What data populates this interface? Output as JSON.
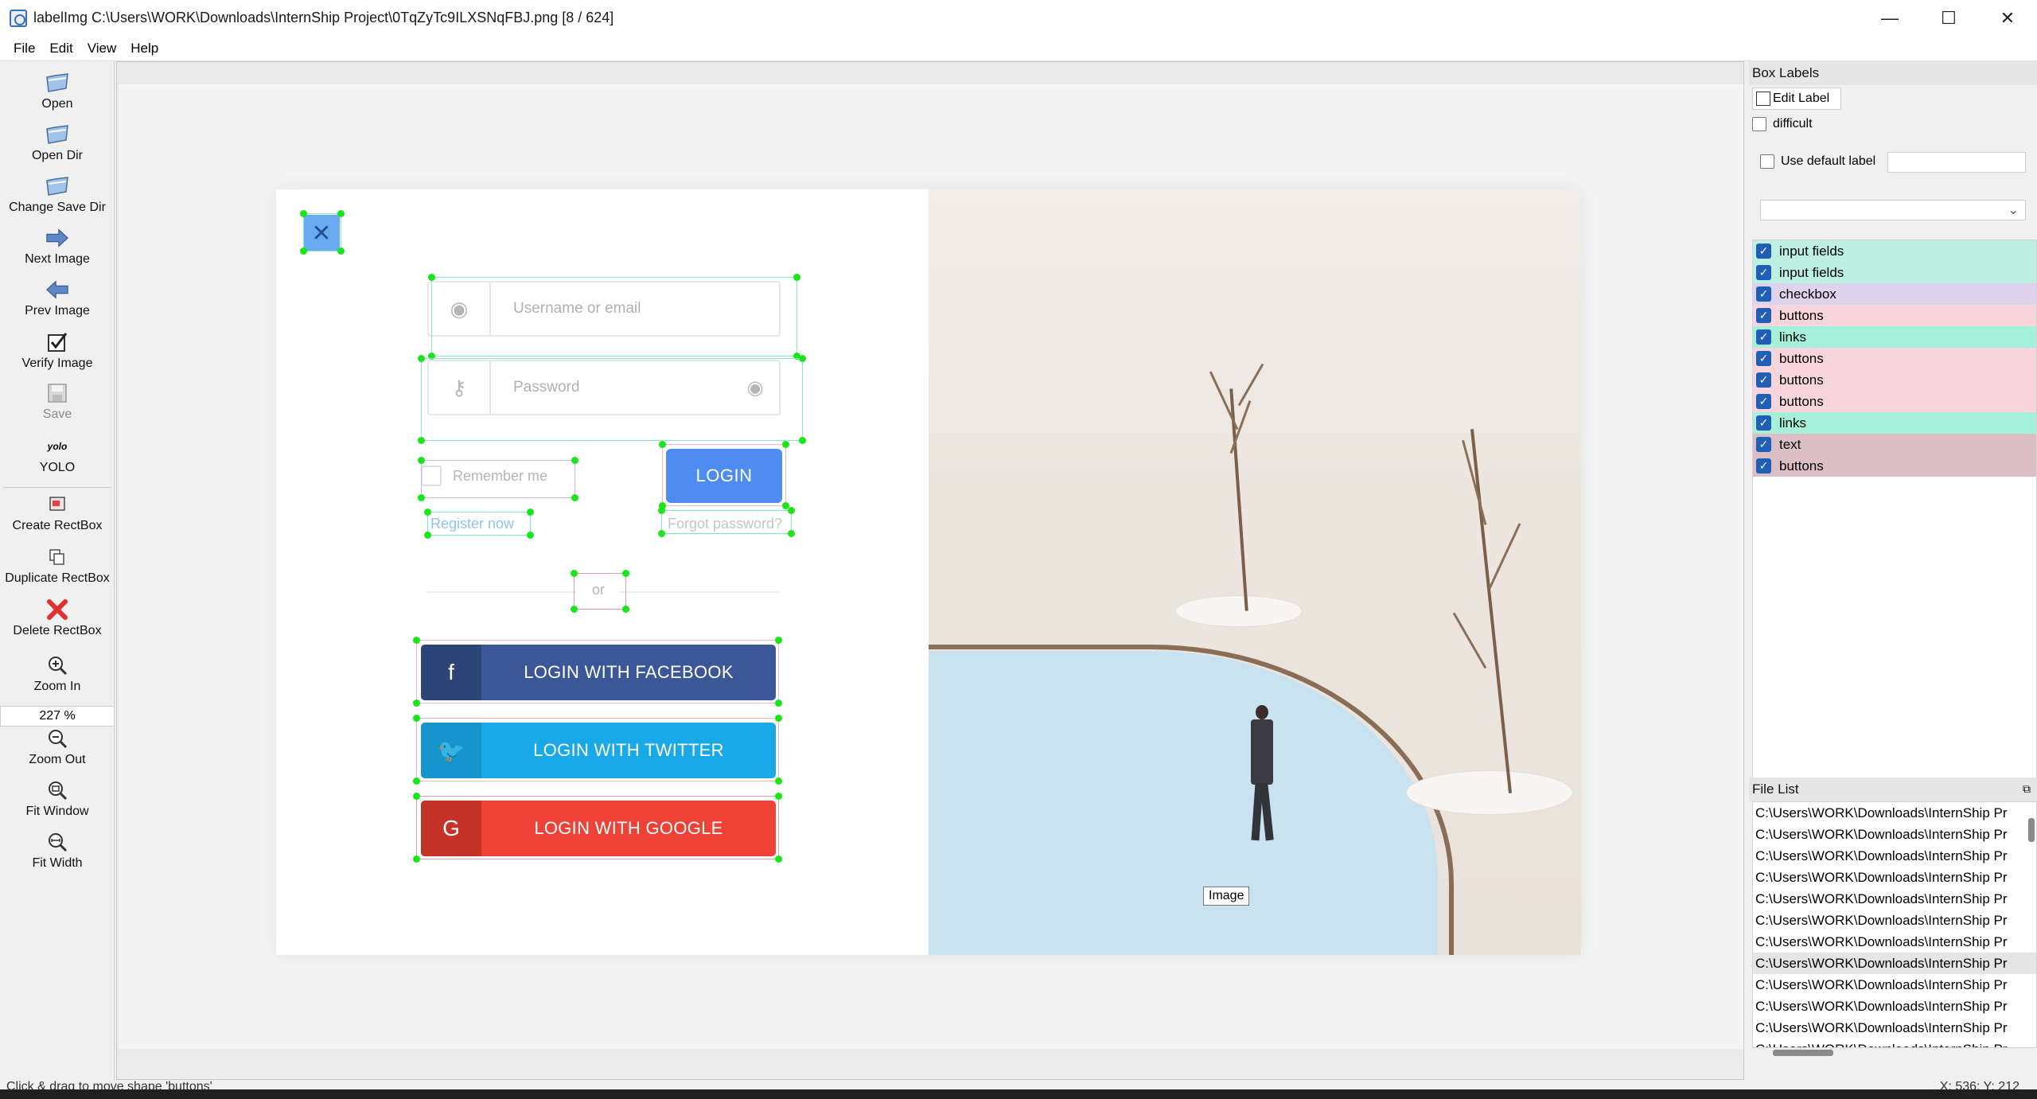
{
  "window": {
    "title": "labelImg C:\\Users\\WORK\\Downloads\\InternShip Project\\0TqZyTc9ILXSNqFBJ.png [8 / 624]",
    "minimize": "—",
    "maximize": "☐",
    "close": "✕"
  },
  "menu": [
    "File",
    "Edit",
    "View",
    "Help"
  ],
  "toolbar": {
    "open": "Open",
    "open_dir": "Open Dir",
    "change_save_dir": "Change Save Dir",
    "next_image": "Next Image",
    "prev_image": "Prev Image",
    "verify_image": "Verify Image",
    "save": "Save",
    "yolo_icon_text": "yolo",
    "yolo": "YOLO",
    "create_rectbox": "Create RectBox",
    "duplicate_rectbox": "Duplicate RectBox",
    "delete_rectbox": "Delete RectBox",
    "zoom_in": "Zoom In",
    "zoom_value": "227 %",
    "zoom_out": "Zoom Out",
    "fit_window": "Fit Window",
    "fit_width": "Fit Width"
  },
  "canvas": {
    "tooltip": "Image",
    "form": {
      "username_placeholder": "Username or email",
      "password_placeholder": "Password",
      "remember_me": "Remember me",
      "login": "LOGIN",
      "register_now": "Register now",
      "forgot_password": "Forgot password?",
      "or": "or",
      "facebook": "LOGIN WITH FACEBOOK",
      "twitter": "LOGIN WITH TWITTER",
      "google": "LOGIN WITH GOOGLE",
      "close_symbol": "✕"
    }
  },
  "box_labels": {
    "title": "Box Labels",
    "edit_label": "Edit Label",
    "difficult": "difficult",
    "use_default_label": "Use default label",
    "labels": [
      {
        "text": "input fields",
        "color": "#bdf0e2"
      },
      {
        "text": "input fields",
        "color": "#bdf0e2"
      },
      {
        "text": "checkbox",
        "color": "#ded2ec"
      },
      {
        "text": "buttons",
        "color": "#f8d4dc"
      },
      {
        "text": "links",
        "color": "#a6f0da"
      },
      {
        "text": "buttons",
        "color": "#f8d4dc"
      },
      {
        "text": "buttons",
        "color": "#f8d4dc"
      },
      {
        "text": "buttons",
        "color": "#f8d4dc"
      },
      {
        "text": "links",
        "color": "#a6f0da"
      },
      {
        "text": "text",
        "color": "#dcbfc6"
      },
      {
        "text": "buttons",
        "color": "#dcbfc6"
      }
    ]
  },
  "file_list": {
    "title": "File List",
    "items": [
      "C:\\Users\\WORK\\Downloads\\InternShip Pr",
      "C:\\Users\\WORK\\Downloads\\InternShip Pr",
      "C:\\Users\\WORK\\Downloads\\InternShip Pr",
      "C:\\Users\\WORK\\Downloads\\InternShip Pr",
      "C:\\Users\\WORK\\Downloads\\InternShip Pr",
      "C:\\Users\\WORK\\Downloads\\InternShip Pr",
      "C:\\Users\\WORK\\Downloads\\InternShip Pr",
      "C:\\Users\\WORK\\Downloads\\InternShip Pr",
      "C:\\Users\\WORK\\Downloads\\InternShip Pr",
      "C:\\Users\\WORK\\Downloads\\InternShip Pr",
      "C:\\Users\\WORK\\Downloads\\InternShip Pr",
      "C:\\Users\\WORK\\Downloads\\InternShip Pr"
    ],
    "selected_index": 7
  },
  "status": {
    "message": "Click & drag to move shape 'buttons'",
    "coords": "X: 536; Y: 212"
  },
  "colors": {
    "handle": "#19e619",
    "input_fields_box": "#8ee6cf",
    "checkbox_box": "#cdb8e6",
    "buttons_box": "#f0b6c6",
    "links_box": "#7ee7c6",
    "text_box": "#d8a0ac"
  }
}
